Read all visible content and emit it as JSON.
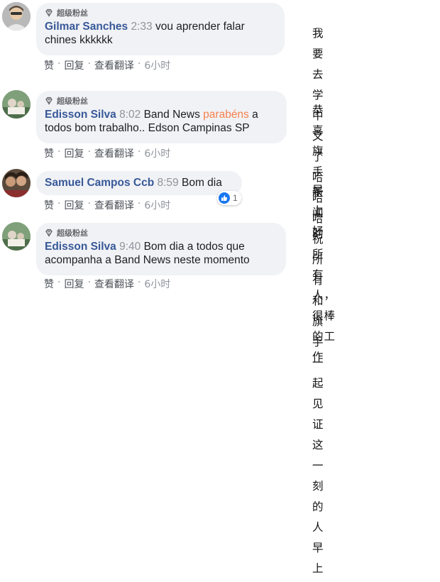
{
  "badge_label": "超级粉丝",
  "actions": {
    "like": "赞",
    "reply": "回复",
    "translate": "查看翻译",
    "sep": "·"
  },
  "comments": [
    {
      "author": "Gilmar Sanches",
      "time": "2:33",
      "text_line1": "vou aprender falar",
      "text_line2": "chines kkkkkk",
      "ago": "6小时",
      "translation_line1": "我要去学中文了哈哈哈"
    },
    {
      "author": "Edisson Silva",
      "time": "8:02",
      "text_line1_a": "Band News ",
      "text_line1_highlight": "parabéns",
      "text_line1_b": " a",
      "text_line2": "todos bom trabalho.. Edson Campinas SP",
      "ago": "6小时",
      "translation_line1": "恭 喜 旗 手 新 闻 的 所 有",
      "translation_line2": "人，很棒的工作"
    },
    {
      "author": "Samuel Campos Ccb",
      "time": "8:59",
      "text_line1": "Bom dia",
      "ago": "6小时",
      "reaction_count": "1",
      "translation_line1": "早上好"
    },
    {
      "author": "Edisson Silva",
      "time": "9:40",
      "text_line1": "Bom dia a todos que",
      "text_line2": "acompanha a Band News neste momento",
      "ago": "6小时",
      "translation_line1": "祝所有和旗手一起见证",
      "translation_line2": "这一刻的人早上好"
    }
  ]
}
